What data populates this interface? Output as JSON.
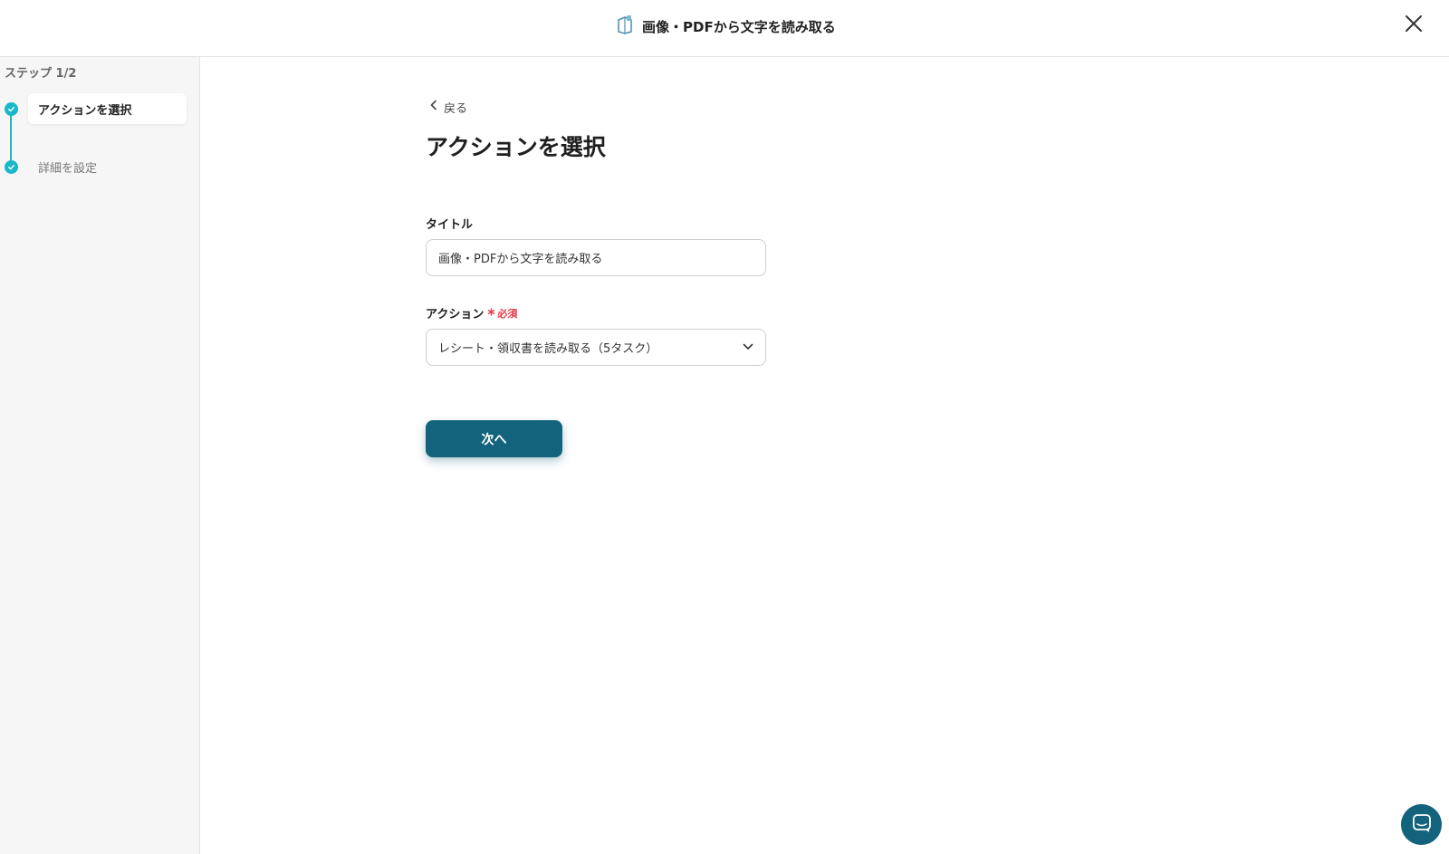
{
  "header": {
    "title": "画像・PDFから文字を読み取る",
    "icon": "ocr-app-icon",
    "close_icon": "close-icon"
  },
  "sidebar": {
    "step_count": "ステップ 1/2",
    "steps": [
      {
        "label": "アクションを選択",
        "state": "active"
      },
      {
        "label": "詳細を設定",
        "state": "inactive"
      }
    ]
  },
  "main": {
    "back_label": "戻る",
    "page_title": "アクションを選択",
    "title_field": {
      "label": "タイトル",
      "value": "画像・PDFから文字を読み取る"
    },
    "action_field": {
      "label": "アクション",
      "required_label": "必須",
      "selected": "レシート・領収書を読み取る（5タスク）"
    },
    "next_label": "次へ"
  },
  "colors": {
    "accent": "#14637d",
    "step": "#1ab7c9",
    "required": "#e23a4a"
  }
}
